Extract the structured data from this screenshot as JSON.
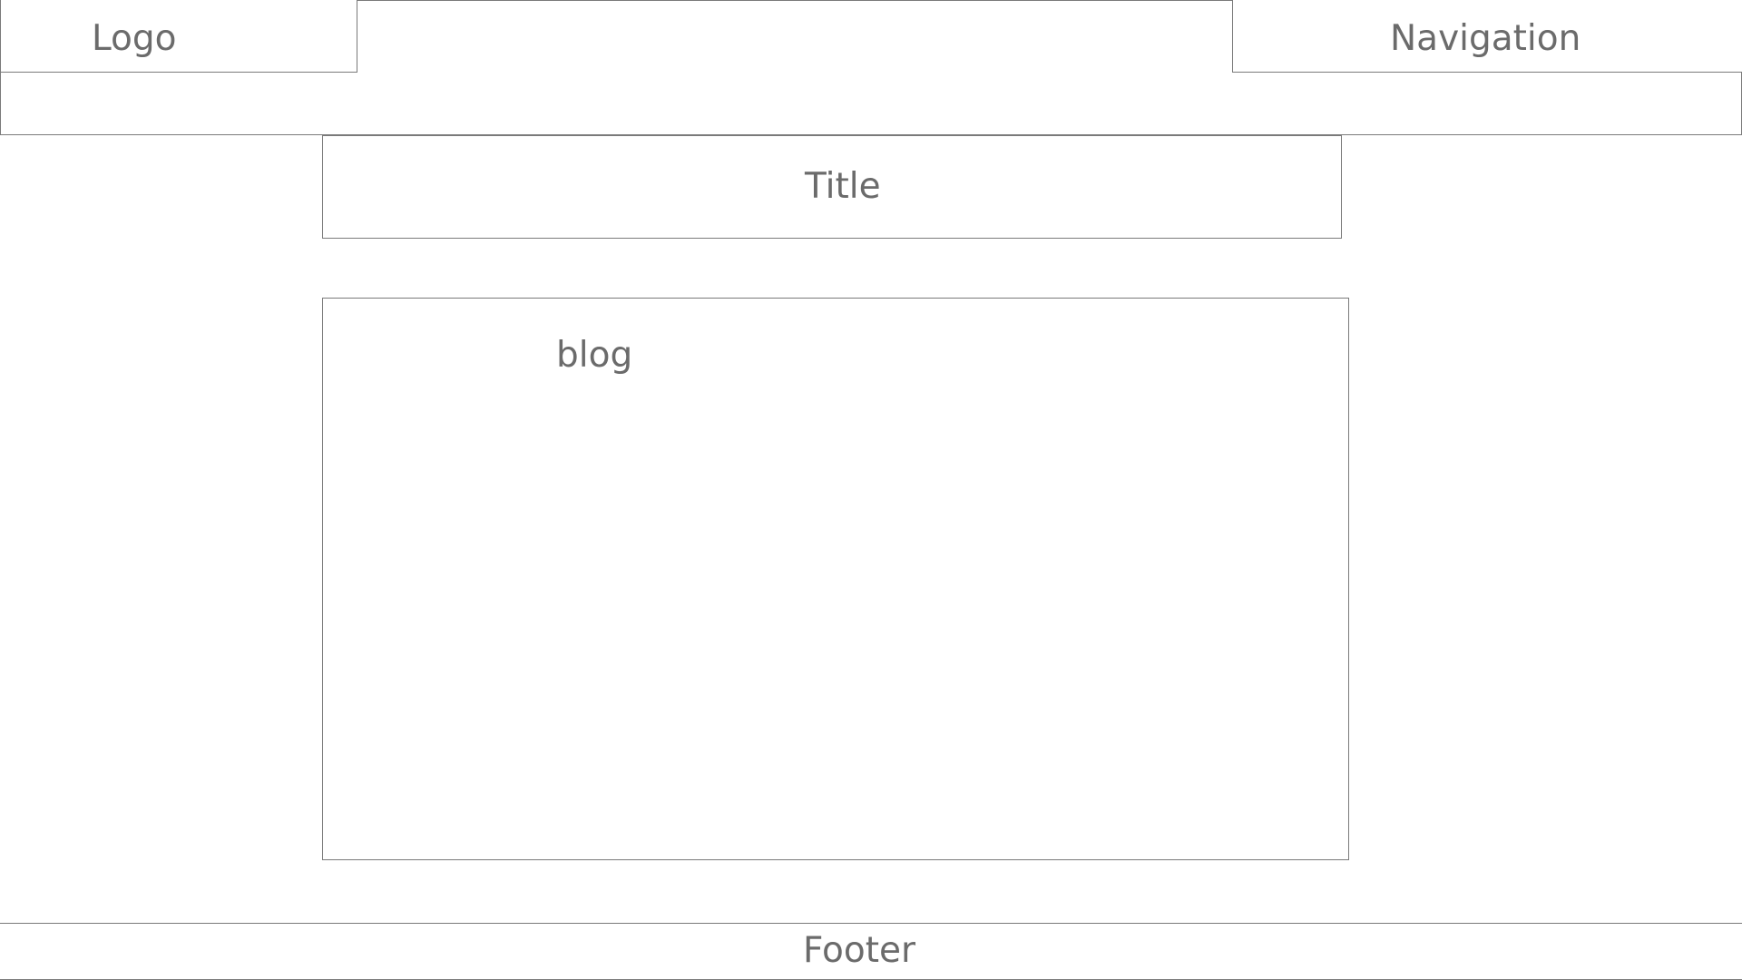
{
  "header": {
    "logo_label": "Logo",
    "navigation_label": "Navigation"
  },
  "main": {
    "title_label": "Title",
    "blog_label": "blog"
  },
  "footer": {
    "footer_label": "Footer"
  },
  "colors": {
    "border": "#7a7a7a",
    "text": "#6b6b6b",
    "background": "#ffffff"
  }
}
